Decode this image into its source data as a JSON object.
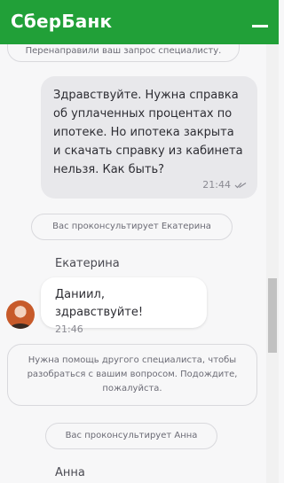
{
  "header": {
    "title": "СберБанк"
  },
  "chat": {
    "system_top": "Перенаправили ваш запрос специалисту.",
    "user_message": {
      "text": "Здравствуйте. Нужна справка об уплаченных процентах по ипотеке. Но ипотека закрыта и скачать справку из кабинета нельзя. Как быть?",
      "time": "21:44"
    },
    "system_katerina": "Вас проконсультирует Екатерина",
    "agent_katerina": {
      "name": "Екатерина",
      "text": "Даниил, здравствуйте!",
      "time": "21:46"
    },
    "system_help": "Нужна помощь другого специалиста, чтобы разобраться с вашим вопросом. Подождите, пожалуйста.",
    "system_anna": "Вас проконсультирует Анна",
    "agent_anna": {
      "name": "Анна"
    }
  },
  "colors": {
    "brand": "#21a038",
    "bubble_out": "#e8e8eb",
    "bubble_in": "#ffffff"
  }
}
